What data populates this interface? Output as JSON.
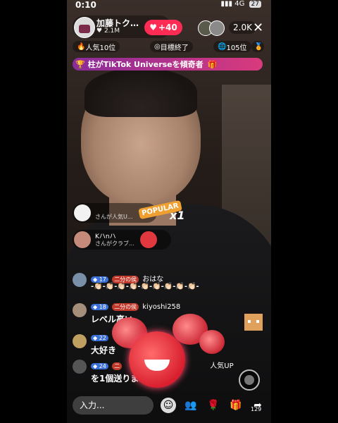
{
  "status_bar": {
    "time": "0:10",
    "network": "4G",
    "battery": "27"
  },
  "host": {
    "name": "加藤トク…",
    "likes": "2.1M",
    "follow_label": "+40"
  },
  "viewers": {
    "count": "2.0K"
  },
  "ranks": {
    "popular": "人気10位",
    "goal": "目標終了",
    "rank": "105位"
  },
  "banner": {
    "text": "柱がTikTok Universeを傾奇者"
  },
  "notifications": [
    {
      "user": "",
      "text": "さんが人気U...",
      "gift": "POPULAR",
      "multiplier": "x1"
    },
    {
      "user": "Kハnハ",
      "text": "さんがクラブ..."
    }
  ],
  "chat": [
    {
      "level": "17",
      "team": "二分の侯",
      "name": "おはな",
      "message": "-👏🏻-👏🏻-👏🏻-👏🏻-👏🏻-👏🏻-👏🏻-👏🏻-👏🏻-"
    },
    {
      "level": "18",
      "team": "二分の侯",
      "name": "kiyoshi258",
      "message": "レベル高い"
    },
    {
      "level": "22",
      "team": "",
      "name": "",
      "message": "大好き"
    },
    {
      "level": "24",
      "team": "二",
      "name": "",
      "message": "を1個送りま",
      "extra": "人気UP"
    }
  ],
  "bottom": {
    "input_placeholder": "入力...",
    "share_count": "129"
  }
}
